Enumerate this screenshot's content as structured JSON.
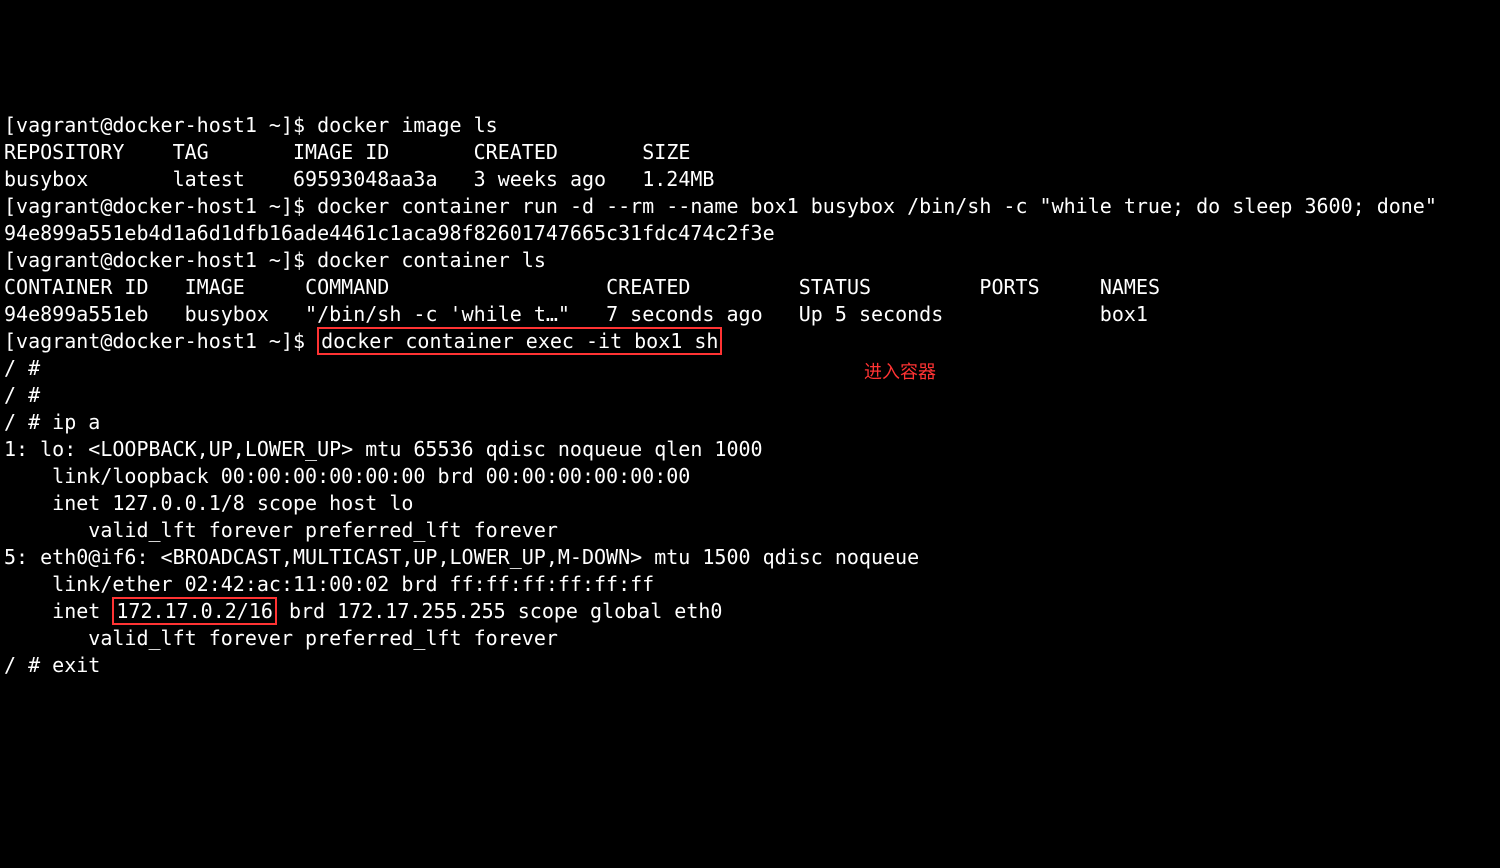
{
  "prompt1": "[vagrant@docker-host1 ~]$ ",
  "cmd1": "docker image ls",
  "header_repository": "REPOSITORY",
  "header_tag": "TAG",
  "header_imageid": "IMAGE ID",
  "header_created": "CREATED",
  "header_size": "SIZE",
  "img_repo": "busybox",
  "img_tag": "latest",
  "img_id": "69593048aa3a",
  "img_created": "3 weeks ago",
  "img_size": "1.24MB",
  "prompt2": "[vagrant@docker-host1 ~]$ ",
  "cmd2": "docker container run -d --rm --name box1 busybox /bin/sh -c \"while true; do sleep 3600; done\"",
  "container_hash": "94e899a551eb4d1a6d1dfb16ade4461c1aca98f82601747665c31fdc474c2f3e",
  "prompt3": "[vagrant@docker-host1 ~]$ ",
  "cmd3": "docker container ls",
  "header_container_id": "CONTAINER ID",
  "header_image": "IMAGE",
  "header_command": "COMMAND",
  "header_created2": "CREATED",
  "header_status": "STATUS",
  "header_ports": "PORTS",
  "header_names": "NAMES",
  "cont_id": "94e899a551eb",
  "cont_image": "busybox",
  "cont_command": "\"/bin/sh -c 'while t…\"",
  "cont_created": "7 seconds ago",
  "cont_status": "Up 5 seconds",
  "cont_ports": "",
  "cont_names": "box1",
  "prompt4": "[vagrant@docker-host1 ~]$ ",
  "cmd4": "docker container exec -it box1 sh",
  "annotation_text": "进入容器",
  "sh_prompt1": "/ # ",
  "sh_prompt2": "/ # ",
  "sh_prompt3": "/ # ",
  "cmd_ipa": "ip a",
  "ip_line1": "1: lo: <LOOPBACK,UP,LOWER_UP> mtu 65536 qdisc noqueue qlen 1000",
  "ip_line2": "    link/loopback 00:00:00:00:00:00 brd 00:00:00:00:00:00",
  "ip_line3": "    inet 127.0.0.1/8 scope host lo",
  "ip_line4": "       valid_lft forever preferred_lft forever",
  "ip_line5": "5: eth0@if6: <BROADCAST,MULTICAST,UP,LOWER_UP,M-DOWN> mtu 1500 qdisc noqueue",
  "ip_line6": "    link/ether 02:42:ac:11:00:02 brd ff:ff:ff:ff:ff:ff",
  "ip_line7a": "    inet ",
  "ip_boxed": "172.17.0.2/16",
  "ip_line7b": " brd 172.17.255.255 scope global eth0",
  "ip_line8": "       valid_lft forever preferred_lft forever",
  "sh_prompt4": "/ # ",
  "cmd_exit": "exit"
}
